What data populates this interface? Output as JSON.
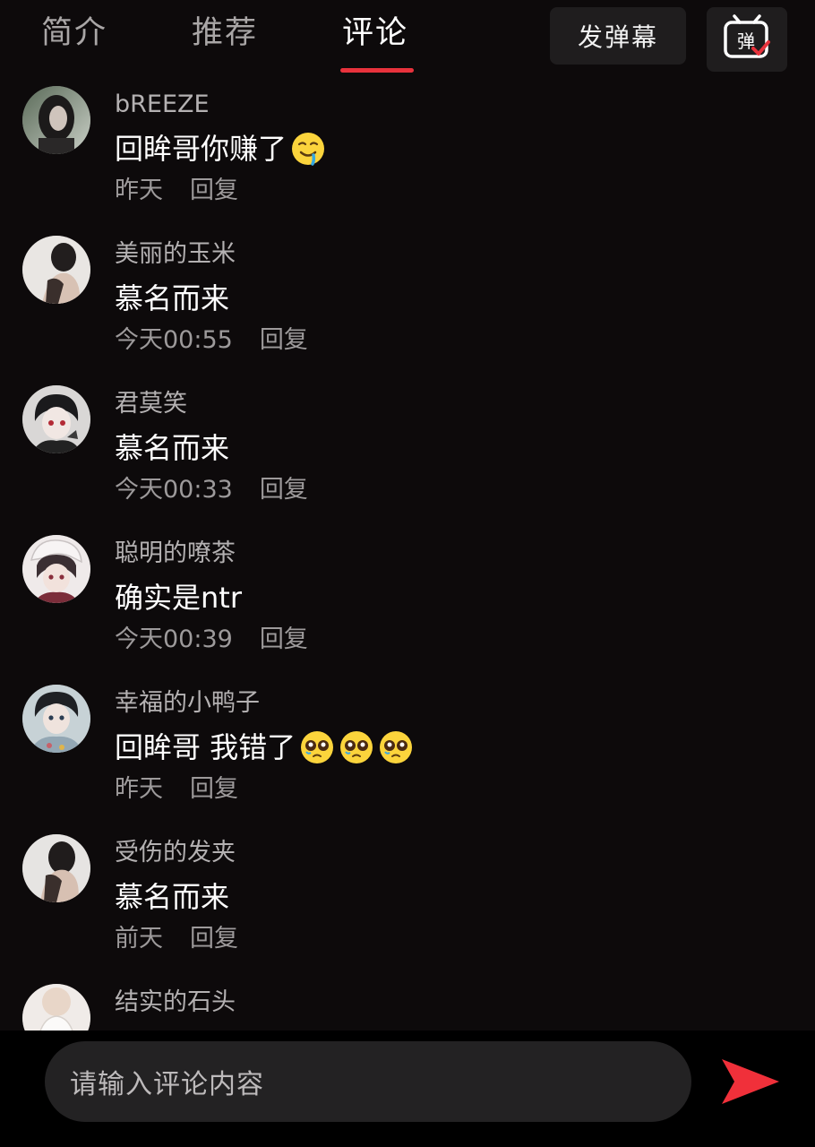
{
  "tabs": [
    {
      "label": "简介",
      "active": false
    },
    {
      "label": "推荐",
      "active": false
    },
    {
      "label": "评论",
      "active": true
    }
  ],
  "header": {
    "danmaku_button": "发弹幕",
    "danmaku_toggle_icon": "弹"
  },
  "comments": [
    {
      "user": "bREEZE",
      "text": "回眸哥你赚了",
      "emoji": [
        "drooling-face-emoji"
      ],
      "time": "昨天",
      "reply": "回复"
    },
    {
      "user": "美丽的玉米",
      "text": "慕名而来",
      "emoji": [],
      "time": "今天00:55",
      "reply": "回复"
    },
    {
      "user": "君莫笑",
      "text": "慕名而来",
      "emoji": [],
      "time": "今天00:33",
      "reply": "回复"
    },
    {
      "user": "聪明的嘹茶",
      "text": "确实是ntr",
      "emoji": [],
      "time": "今天00:39",
      "reply": "回复"
    },
    {
      "user": "幸福的小鸭子",
      "text": "回眸哥 我错了",
      "emoji": [
        "pleading-face-emoji",
        "pleading-face-emoji",
        "pleading-face-emoji"
      ],
      "time": "昨天",
      "reply": "回复"
    },
    {
      "user": "受伤的发夹",
      "text": "慕名而来",
      "emoji": [],
      "time": "前天",
      "reply": "回复"
    },
    {
      "user": "结实的石头",
      "text": "",
      "emoji": [],
      "time": "",
      "reply": ""
    }
  ],
  "input": {
    "placeholder": "请输入评论内容"
  },
  "colors": {
    "background": "#0d0a0b",
    "accent": "#e8323c",
    "send": "#f0303a"
  }
}
